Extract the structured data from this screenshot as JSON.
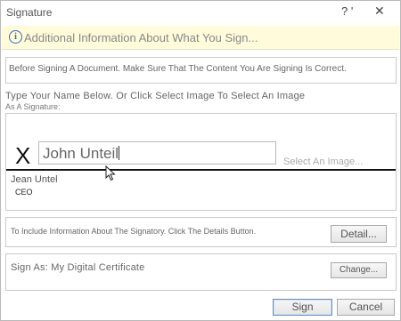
{
  "window": {
    "title": "Signature",
    "help_label": "? '",
    "close_label": "✕"
  },
  "info_bar": {
    "icon": "info-icon",
    "icon_glyph": "i",
    "text": "Additional Information About What You Sign..."
  },
  "warning": {
    "text": "Before Signing A Document. Make Sure That The Content You Are Signing Is Correct."
  },
  "instructions": {
    "line1": "Type Your Name Below. Or Click Select Image To Select An Image",
    "line2": "As A Signature:"
  },
  "signature": {
    "x_mark": "X",
    "typed_name": "John Unteil",
    "select_image_link": "Select An Image...",
    "signer_name": "Jean Untel",
    "signer_title": "CEO"
  },
  "details": {
    "text": "To Include Information About The Signatory. Click The Details Button.",
    "button_label": "Detail..."
  },
  "sign_as": {
    "text": "Sign As: My Digital Certificate",
    "button_label": "Change..."
  },
  "footer": {
    "sign_label": "Sign",
    "cancel_label": "Cancel"
  },
  "colors": {
    "info_background": "#fffbdb",
    "info_icon": "#2f6fb7",
    "default_button_border": "#5b8fd0"
  }
}
